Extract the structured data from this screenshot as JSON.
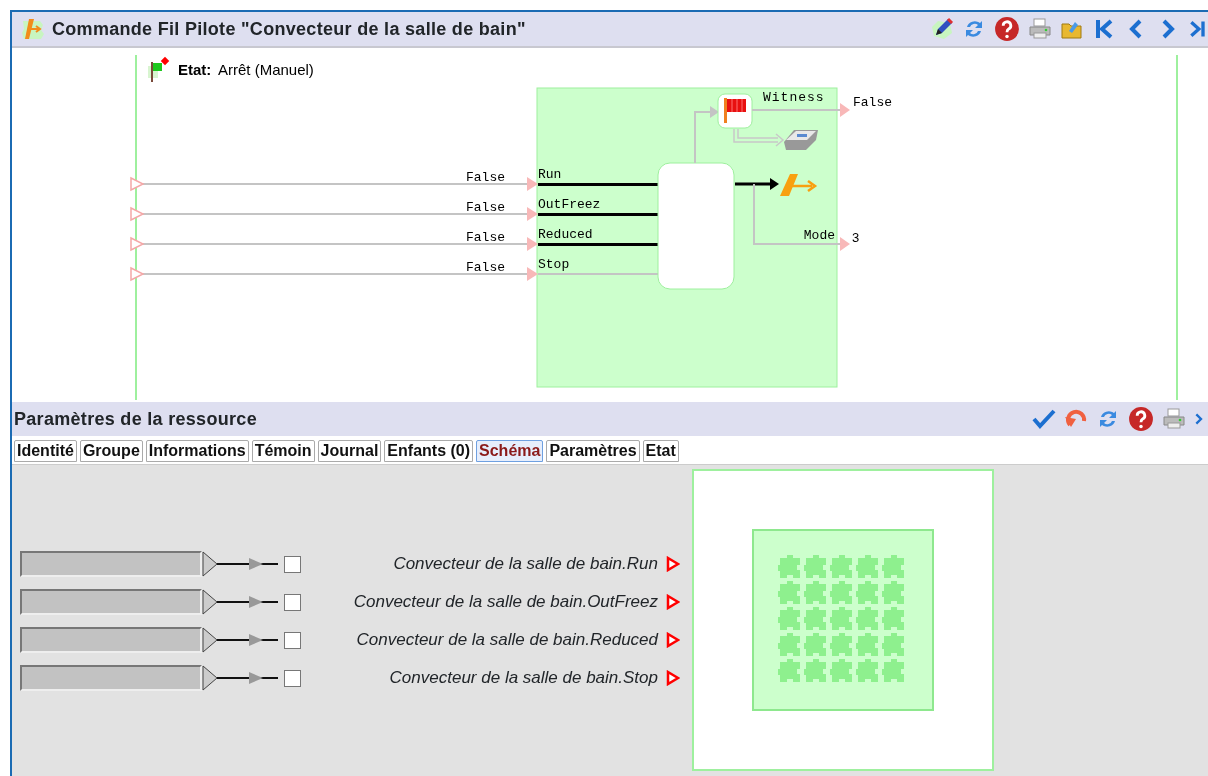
{
  "window": {
    "title": "Commande Fil Pilote \"Convecteur de la salle de bain\""
  },
  "state": {
    "label": "Etat:",
    "value": "Arrêt (Manuel)"
  },
  "diagram": {
    "inputs": [
      {
        "value": "False",
        "port": "Run",
        "active": true
      },
      {
        "value": "False",
        "port": "OutFreez",
        "active": true
      },
      {
        "value": "False",
        "port": "Reduced",
        "active": true
      },
      {
        "value": "False",
        "port": "Stop",
        "active": false
      }
    ],
    "witness": {
      "label": "Witness",
      "value": "False"
    },
    "mode": {
      "label": "Mode",
      "value": "3"
    }
  },
  "panel": {
    "title": "Paramètres de la ressource",
    "tabs": [
      {
        "label": "Identité",
        "selected": false
      },
      {
        "label": "Groupe",
        "selected": false
      },
      {
        "label": "Informations",
        "selected": false
      },
      {
        "label": "Témoin",
        "selected": false
      },
      {
        "label": "Journal",
        "selected": false
      },
      {
        "label": "Enfants (0)",
        "selected": false
      },
      {
        "label": "Schéma",
        "selected": true
      },
      {
        "label": "Paramètres",
        "selected": false
      },
      {
        "label": "Etat",
        "selected": false
      }
    ]
  },
  "schema": {
    "rows": [
      {
        "label": "Convecteur de la salle de bain.Run",
        "checked": false
      },
      {
        "label": "Convecteur de la salle de bain.OutFreez",
        "checked": false
      },
      {
        "label": "Convecteur de la salle de bain.Reduced",
        "checked": false
      },
      {
        "label": "Convecteur de la salle de bain.Stop",
        "checked": false
      }
    ]
  }
}
